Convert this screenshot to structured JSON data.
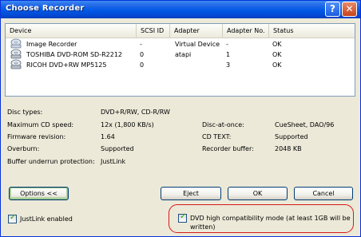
{
  "window": {
    "title": "Choose Recorder"
  },
  "title_buttons": {
    "help": "?",
    "close": "✕"
  },
  "table": {
    "columns": [
      "Device",
      "SCSI ID",
      "Adapter",
      "Adapter No.",
      "Status"
    ],
    "rows": [
      {
        "device": "Image Recorder",
        "scsi_id": "-",
        "adapter": "Virtual Device",
        "adapter_no": "-",
        "status": "OK",
        "icon": "image-recorder-icon"
      },
      {
        "device": "TOSHIBA  DVD-ROM SD-R2212",
        "scsi_id": "0",
        "adapter": "atapi",
        "adapter_no": "1",
        "status": "OK",
        "icon": "optical-drive-icon"
      },
      {
        "device": "RICOH    DVD+RW MP5125",
        "scsi_id": "0",
        "adapter": "",
        "adapter_no": "3",
        "status": "OK",
        "icon": "optical-drive-icon"
      }
    ]
  },
  "info": {
    "disc_types_label": "Disc types:",
    "disc_types_value": "DVD+R/RW, CD-R/RW",
    "max_speed_label": "Maximum CD speed:",
    "max_speed_value": "12x (1,800 KB/s)",
    "firmware_label": "Firmware revision:",
    "firmware_value": "1.64",
    "overburn_label": "Overburn:",
    "overburn_value": "Supported",
    "buffer_protection_label": "Buffer underrun protection:",
    "buffer_protection_value": "JustLink",
    "dao_label": "Disc-at-once:",
    "dao_value": "CueSheet, DAO/96",
    "cdtext_label": "CD TEXT:",
    "cdtext_value": "Supported",
    "recorder_buffer_label": "Recorder buffer:",
    "recorder_buffer_value": "2048 KB"
  },
  "buttons": {
    "options": "Options <<",
    "eject": "Eject",
    "ok": "OK",
    "cancel": "Cancel"
  },
  "checkboxes": {
    "justlink": {
      "label": "JustLink enabled",
      "checked": true
    },
    "dvd_compat": {
      "label_line1": "DVD high compatibility mode (at least 1GB will be",
      "label_line2": "written)",
      "checked": true
    }
  },
  "colors": {
    "title_bar": "#0058e6",
    "face": "#ece9d8",
    "highlight_ring": "#d81818"
  }
}
